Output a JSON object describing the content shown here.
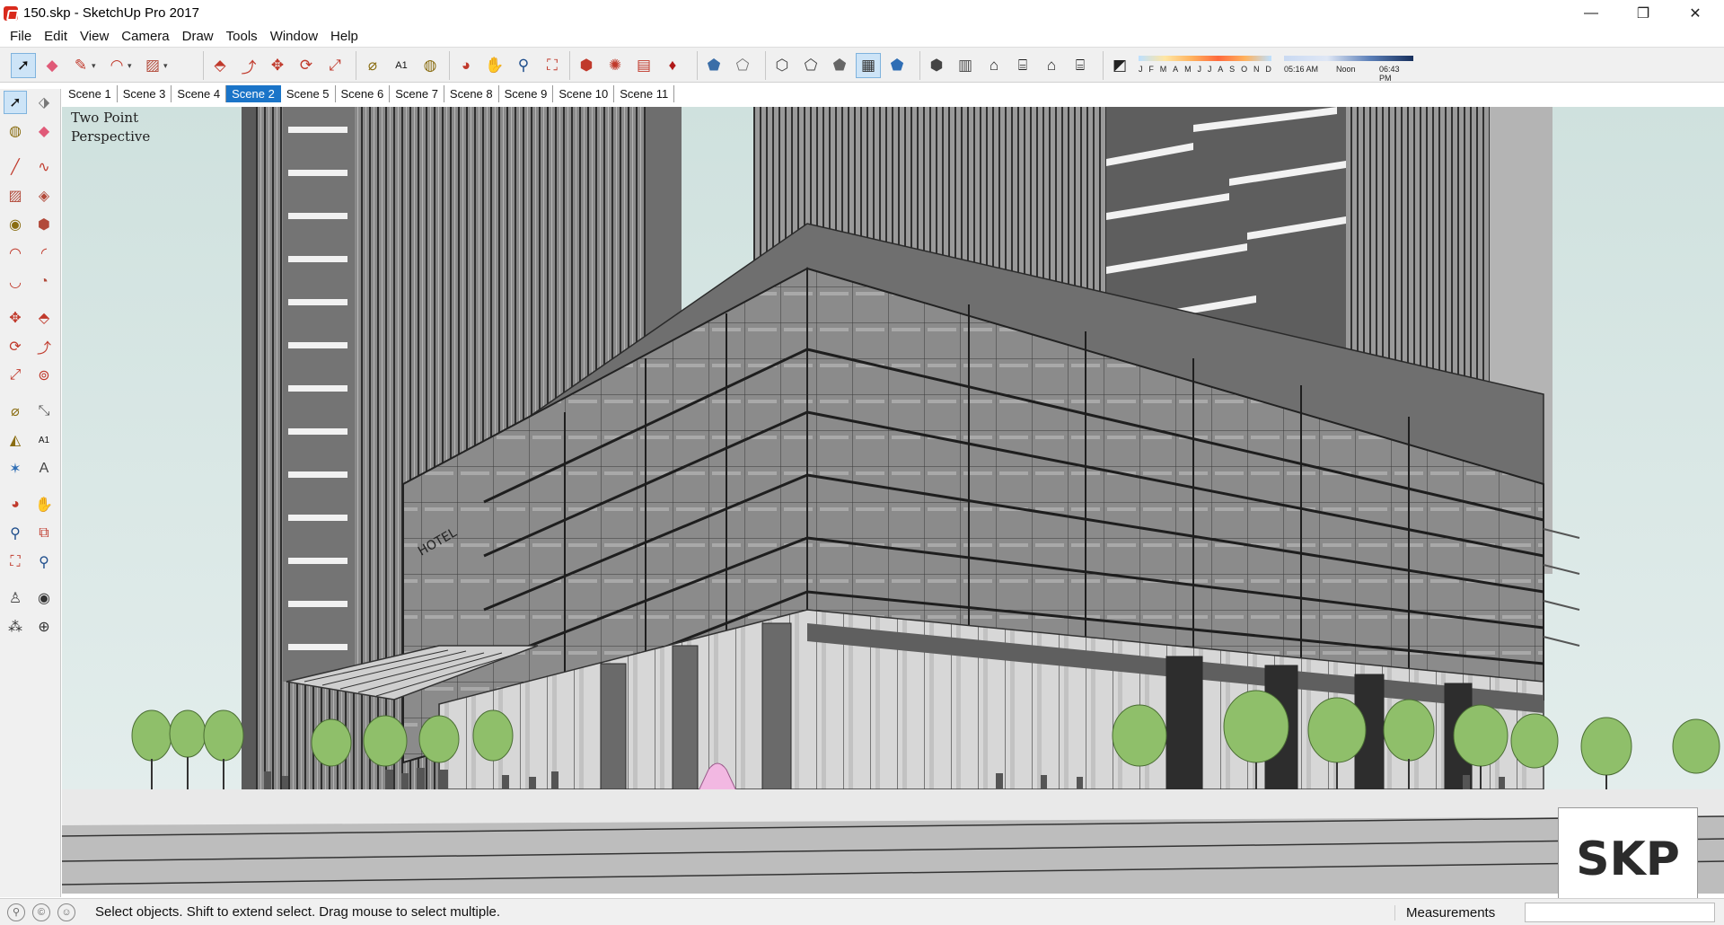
{
  "window": {
    "title": "150.skp - SketchUp Pro 2017",
    "minimize": "—",
    "restore": "❐",
    "close": "✕"
  },
  "menu": [
    "File",
    "Edit",
    "View",
    "Camera",
    "Draw",
    "Tools",
    "Window",
    "Help"
  ],
  "toolbar": {
    "groups": [
      [
        "select-icon",
        "eraser-icon",
        "pencil-icon",
        "arc-icon",
        "rectangle-icon"
      ],
      [
        "push-pull-icon",
        "follow-me-icon",
        "move-icon",
        "rotate-icon",
        "scale-icon"
      ],
      [
        "tape-measure-icon",
        "text-icon",
        "paint-bucket-icon"
      ],
      [
        "orbit-icon",
        "pan-icon",
        "zoom-icon",
        "zoom-extents-icon"
      ],
      [
        "warehouse-icon",
        "extension-warehouse-icon",
        "layout-icon",
        "ruby-icon"
      ],
      [
        "xray-icon",
        "back-edges-icon"
      ],
      [
        "wireframe-icon",
        "hidden-line-icon",
        "shaded-icon",
        "shaded-textures-icon",
        "monochrome-icon"
      ],
      [
        "iso-view-icon",
        "top-view-icon",
        "front-view-icon",
        "right-view-icon",
        "back-view-icon",
        "left-view-icon"
      ],
      [
        "shadows-icon"
      ]
    ]
  },
  "shadows": {
    "months": [
      "J",
      "F",
      "M",
      "A",
      "M",
      "J",
      "J",
      "A",
      "S",
      "O",
      "N",
      "D"
    ],
    "time_start": "05:16 AM",
    "time_noon": "Noon",
    "time_end": "06:43 PM"
  },
  "scenes": {
    "tabs": [
      "Scene 1",
      "Scene 3",
      "Scene 4",
      "Scene 2",
      "Scene 5",
      "Scene 6",
      "Scene 7",
      "Scene 8",
      "Scene 9",
      "Scene 10",
      "Scene 11"
    ],
    "active_index": 3
  },
  "viewport": {
    "camera_line1": "Two Point",
    "camera_line2": "Perspective"
  },
  "watermark": {
    "text": "SKP"
  },
  "status": {
    "hint": "Select objects. Shift to extend select. Drag mouse to select multiple.",
    "measurements_label": "Measurements",
    "measurements_value": ""
  },
  "colors": {
    "accent": "#1a74c8",
    "sky": "#d4e4e2",
    "glass": "#8c8c8c",
    "tree": "#8fbf6a"
  }
}
